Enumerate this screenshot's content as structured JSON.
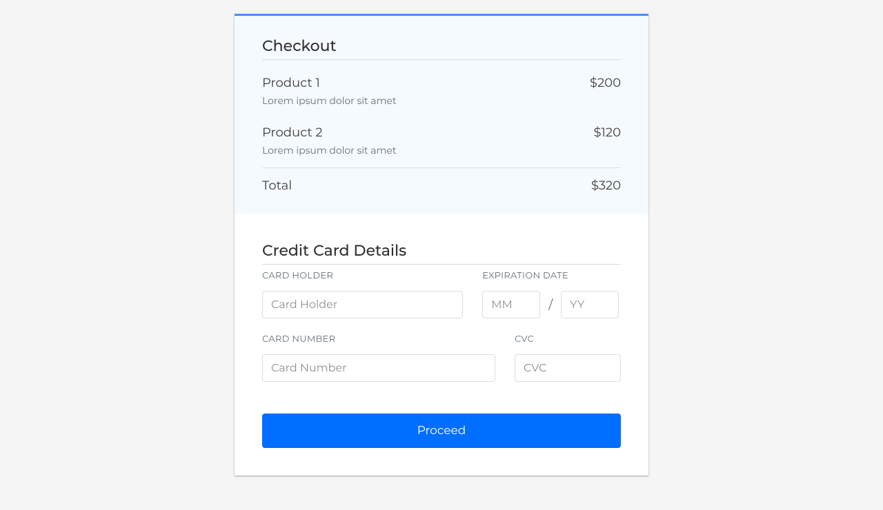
{
  "checkout": {
    "title": "Checkout",
    "items": [
      {
        "name": "Product 1",
        "desc": "Lorem ipsum dolor sit amet",
        "price": "$200"
      },
      {
        "name": "Product 2",
        "desc": "Lorem ipsum dolor sit amet",
        "price": "$120"
      }
    ],
    "totalLabel": "Total",
    "totalValue": "$320"
  },
  "card": {
    "title": "Credit Card Details",
    "holderLabel": "CARD HOLDER",
    "holderPlaceholder": "Card Holder",
    "expLabel": "EXPIRATION DATE",
    "mmPlaceholder": "MM",
    "yyPlaceholder": "YY",
    "numberLabel": "CARD NUMBER",
    "numberPlaceholder": "Card Number",
    "cvcLabel": "CVC",
    "cvcPlaceholder": "CVC",
    "slash": "/"
  },
  "cta": {
    "label": "Proceed"
  }
}
